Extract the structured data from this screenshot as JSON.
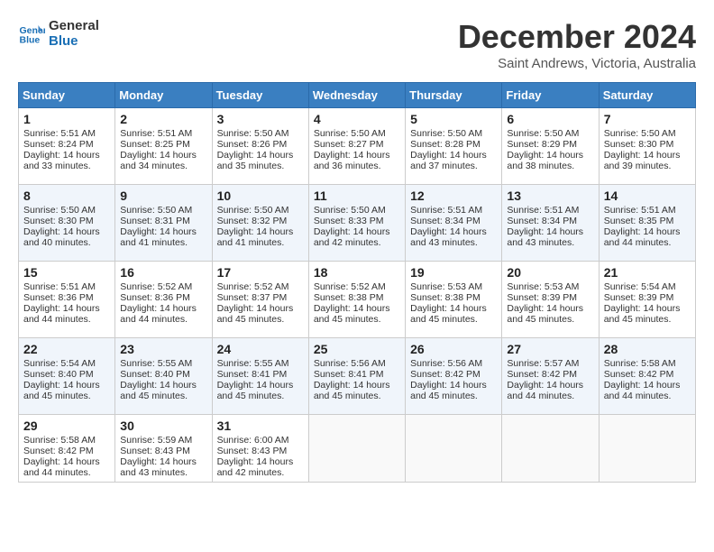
{
  "header": {
    "logo_line1": "General",
    "logo_line2": "Blue",
    "month": "December 2024",
    "location": "Saint Andrews, Victoria, Australia"
  },
  "days_of_week": [
    "Sunday",
    "Monday",
    "Tuesday",
    "Wednesday",
    "Thursday",
    "Friday",
    "Saturday"
  ],
  "weeks": [
    [
      {
        "day": 1,
        "sunrise": "5:51 AM",
        "sunset": "8:24 PM",
        "daylight": "14 hours and 33 minutes."
      },
      {
        "day": 2,
        "sunrise": "5:51 AM",
        "sunset": "8:25 PM",
        "daylight": "14 hours and 34 minutes."
      },
      {
        "day": 3,
        "sunrise": "5:50 AM",
        "sunset": "8:26 PM",
        "daylight": "14 hours and 35 minutes."
      },
      {
        "day": 4,
        "sunrise": "5:50 AM",
        "sunset": "8:27 PM",
        "daylight": "14 hours and 36 minutes."
      },
      {
        "day": 5,
        "sunrise": "5:50 AM",
        "sunset": "8:28 PM",
        "daylight": "14 hours and 37 minutes."
      },
      {
        "day": 6,
        "sunrise": "5:50 AM",
        "sunset": "8:29 PM",
        "daylight": "14 hours and 38 minutes."
      },
      {
        "day": 7,
        "sunrise": "5:50 AM",
        "sunset": "8:30 PM",
        "daylight": "14 hours and 39 minutes."
      }
    ],
    [
      {
        "day": 8,
        "sunrise": "5:50 AM",
        "sunset": "8:30 PM",
        "daylight": "14 hours and 40 minutes."
      },
      {
        "day": 9,
        "sunrise": "5:50 AM",
        "sunset": "8:31 PM",
        "daylight": "14 hours and 41 minutes."
      },
      {
        "day": 10,
        "sunrise": "5:50 AM",
        "sunset": "8:32 PM",
        "daylight": "14 hours and 41 minutes."
      },
      {
        "day": 11,
        "sunrise": "5:50 AM",
        "sunset": "8:33 PM",
        "daylight": "14 hours and 42 minutes."
      },
      {
        "day": 12,
        "sunrise": "5:51 AM",
        "sunset": "8:34 PM",
        "daylight": "14 hours and 43 minutes."
      },
      {
        "day": 13,
        "sunrise": "5:51 AM",
        "sunset": "8:34 PM",
        "daylight": "14 hours and 43 minutes."
      },
      {
        "day": 14,
        "sunrise": "5:51 AM",
        "sunset": "8:35 PM",
        "daylight": "14 hours and 44 minutes."
      }
    ],
    [
      {
        "day": 15,
        "sunrise": "5:51 AM",
        "sunset": "8:36 PM",
        "daylight": "14 hours and 44 minutes."
      },
      {
        "day": 16,
        "sunrise": "5:52 AM",
        "sunset": "8:36 PM",
        "daylight": "14 hours and 44 minutes."
      },
      {
        "day": 17,
        "sunrise": "5:52 AM",
        "sunset": "8:37 PM",
        "daylight": "14 hours and 45 minutes."
      },
      {
        "day": 18,
        "sunrise": "5:52 AM",
        "sunset": "8:38 PM",
        "daylight": "14 hours and 45 minutes."
      },
      {
        "day": 19,
        "sunrise": "5:53 AM",
        "sunset": "8:38 PM",
        "daylight": "14 hours and 45 minutes."
      },
      {
        "day": 20,
        "sunrise": "5:53 AM",
        "sunset": "8:39 PM",
        "daylight": "14 hours and 45 minutes."
      },
      {
        "day": 21,
        "sunrise": "5:54 AM",
        "sunset": "8:39 PM",
        "daylight": "14 hours and 45 minutes."
      }
    ],
    [
      {
        "day": 22,
        "sunrise": "5:54 AM",
        "sunset": "8:40 PM",
        "daylight": "14 hours and 45 minutes."
      },
      {
        "day": 23,
        "sunrise": "5:55 AM",
        "sunset": "8:40 PM",
        "daylight": "14 hours and 45 minutes."
      },
      {
        "day": 24,
        "sunrise": "5:55 AM",
        "sunset": "8:41 PM",
        "daylight": "14 hours and 45 minutes."
      },
      {
        "day": 25,
        "sunrise": "5:56 AM",
        "sunset": "8:41 PM",
        "daylight": "14 hours and 45 minutes."
      },
      {
        "day": 26,
        "sunrise": "5:56 AM",
        "sunset": "8:42 PM",
        "daylight": "14 hours and 45 minutes."
      },
      {
        "day": 27,
        "sunrise": "5:57 AM",
        "sunset": "8:42 PM",
        "daylight": "14 hours and 44 minutes."
      },
      {
        "day": 28,
        "sunrise": "5:58 AM",
        "sunset": "8:42 PM",
        "daylight": "14 hours and 44 minutes."
      }
    ],
    [
      {
        "day": 29,
        "sunrise": "5:58 AM",
        "sunset": "8:42 PM",
        "daylight": "14 hours and 44 minutes."
      },
      {
        "day": 30,
        "sunrise": "5:59 AM",
        "sunset": "8:43 PM",
        "daylight": "14 hours and 43 minutes."
      },
      {
        "day": 31,
        "sunrise": "6:00 AM",
        "sunset": "8:43 PM",
        "daylight": "14 hours and 42 minutes."
      },
      null,
      null,
      null,
      null
    ]
  ]
}
